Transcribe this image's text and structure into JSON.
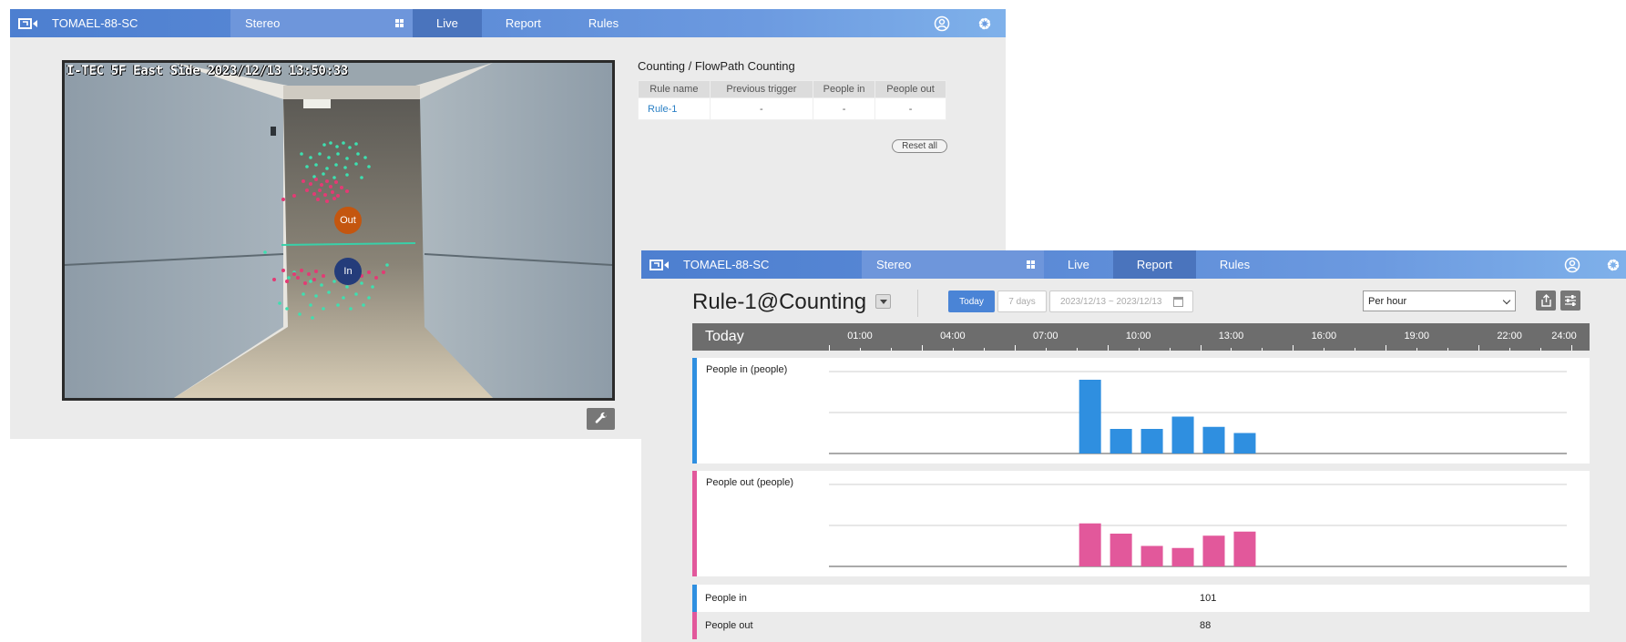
{
  "app": {
    "device_name": "TOMAEL-88-SC",
    "stereo_label": "Stereo",
    "nav": [
      "Live",
      "Report",
      "Rules"
    ]
  },
  "live": {
    "camera_timestamp": "I-TEC 5F East Side 2023/12/13 13:50:33",
    "marker_out": "Out",
    "marker_in": "In",
    "counting": {
      "title": "Counting / FlowPath Counting",
      "columns": [
        "Rule name",
        "Previous trigger",
        "People in",
        "People out"
      ],
      "rows": [
        [
          "Rule-1",
          "-",
          "-",
          "-"
        ]
      ],
      "reset_label": "Reset all"
    }
  },
  "report": {
    "title": "Rule-1@Counting",
    "today_label": "Today",
    "seven_days_label": "7 days",
    "date_range": "2023/12/13 ~ 2023/12/13",
    "period_select": "Per hour",
    "timeline": {
      "label": "Today",
      "tick_labels": [
        "01:00",
        "04:00",
        "07:00",
        "10:00",
        "13:00",
        "16:00",
        "19:00",
        "22:00",
        "24:00"
      ]
    },
    "colors": {
      "people_in": "#2f8fe0",
      "people_out": "#e2589b",
      "accent": "#4a84d6"
    },
    "totals": [
      {
        "label": "People in",
        "value": "101"
      },
      {
        "label": "People out",
        "value": "88"
      }
    ]
  },
  "chart_data": [
    {
      "type": "bar",
      "title": "People in (people)",
      "categories": [
        "08:00",
        "09:00",
        "10:00",
        "11:00",
        "12:00",
        "13:00"
      ],
      "values": [
        36,
        12,
        12,
        18,
        13,
        10
      ],
      "ylim": [
        0,
        40
      ],
      "grid": true
    },
    {
      "type": "bar",
      "title": "People out (people)",
      "categories": [
        "08:00",
        "09:00",
        "10:00",
        "11:00",
        "12:00",
        "13:00"
      ],
      "values": [
        21,
        16,
        10,
        9,
        15,
        17
      ],
      "ylim": [
        0,
        40
      ],
      "grid": true
    }
  ]
}
